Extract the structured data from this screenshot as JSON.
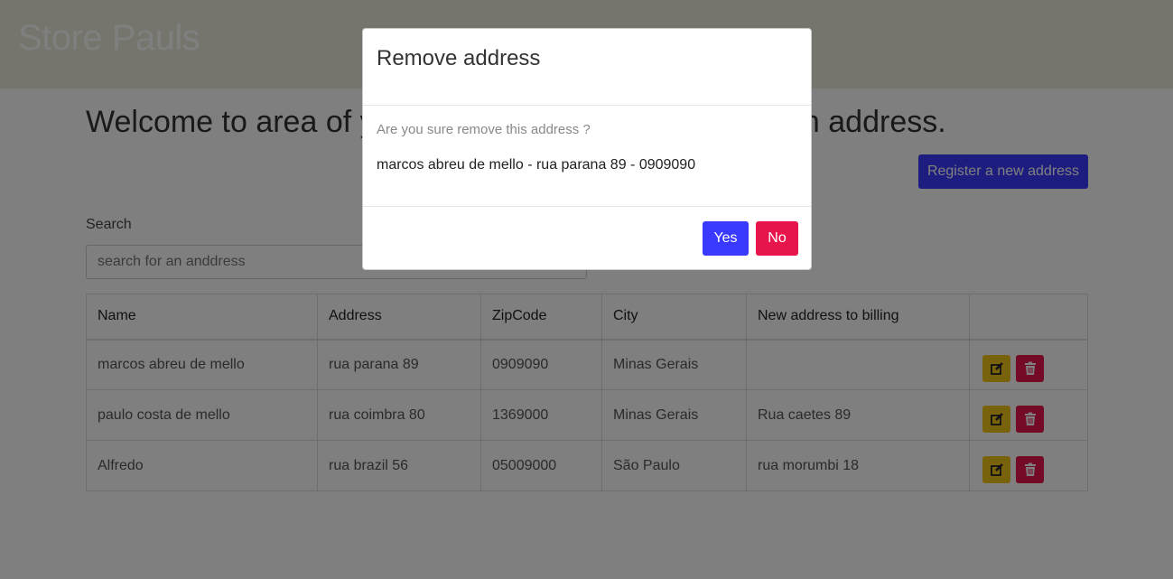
{
  "brand": "Store Pauls",
  "welcome_start": "Welcome to area of yo",
  "welcome_end": "an address.",
  "register_button": "Register a new address",
  "search": {
    "label": "Search",
    "placeholder": "search for an anddress"
  },
  "table": {
    "headers": [
      "Name",
      "Address",
      "ZipCode",
      "City",
      "New address to billing",
      ""
    ],
    "rows": [
      {
        "name": "marcos abreu de mello",
        "address": "rua parana 89",
        "zip": "0909090",
        "city": "Minas Gerais",
        "billing": ""
      },
      {
        "name": "paulo costa de mello",
        "address": "rua coimbra 80",
        "zip": "1369000",
        "city": "Minas Gerais",
        "billing": "Rua caetes 89"
      },
      {
        "name": "Alfredo",
        "address": "rua brazil 56",
        "zip": "05009000",
        "city": "São Paulo",
        "billing": "rua morumbi 18"
      }
    ]
  },
  "modal": {
    "title": "Remove address",
    "question": "Are you sure remove this address ?",
    "detail": "marcos abreu de mello - rua parana 89 - 0909090",
    "yes": "Yes",
    "no": "No"
  },
  "icons": {
    "edit": "edit-icon",
    "delete": "trash-icon"
  },
  "colors": {
    "primary": "#3a3aff",
    "danger": "#e8154d",
    "warning": "#f0c419",
    "navbar": "#ebeada"
  }
}
